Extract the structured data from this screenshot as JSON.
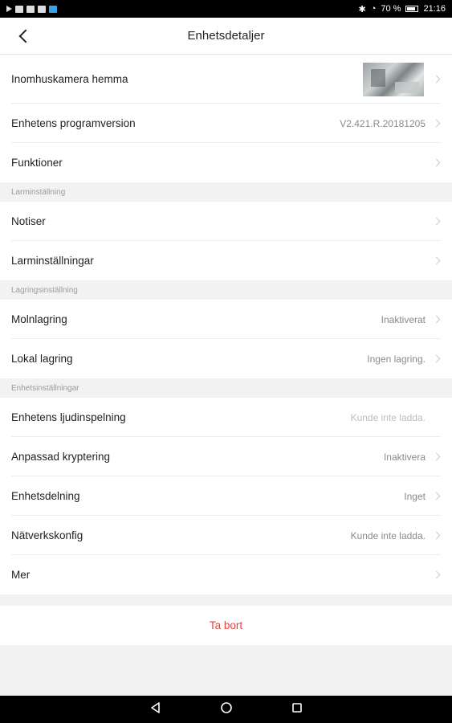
{
  "statusbar": {
    "battery": "70 %",
    "time": "21:16"
  },
  "header": {
    "title": "Enhetsdetaljer"
  },
  "rows_top": [
    {
      "label": "Inomhuskamera hemma",
      "value": ""
    },
    {
      "label": "Enhetens programversion",
      "value": "V2.421.R.20181205"
    },
    {
      "label": "Funktioner",
      "value": ""
    }
  ],
  "section_alarm": {
    "title": "Larminställning"
  },
  "rows_alarm": [
    {
      "label": "Notiser",
      "value": ""
    },
    {
      "label": "Larminställningar",
      "value": ""
    }
  ],
  "section_storage": {
    "title": "Lagringsinställning"
  },
  "rows_storage": [
    {
      "label": "Molnlagring",
      "value": "Inaktiverat"
    },
    {
      "label": "Lokal lagring",
      "value": "Ingen lagring."
    }
  ],
  "section_device": {
    "title": "Enhetsinställningar"
  },
  "rows_device": [
    {
      "label": "Enhetens ljudinspelning",
      "value": "Kunde inte ladda."
    },
    {
      "label": "Anpassad kryptering",
      "value": "Inaktivera"
    },
    {
      "label": "Enhetsdelning",
      "value": "Inget"
    },
    {
      "label": "Nätverkskonfig",
      "value": "Kunde inte ladda."
    },
    {
      "label": "Mer",
      "value": ""
    }
  ],
  "delete_button": {
    "label": "Ta bort"
  },
  "colors": {
    "accent_delete": "#e8413a",
    "background": "#f2f2f2"
  },
  "icons": {
    "back": "chevron-left-icon",
    "chevron": "chevron-right-icon",
    "nav_back": "triangle-back-icon",
    "nav_home": "circle-home-icon",
    "nav_recent": "square-recent-icon"
  }
}
